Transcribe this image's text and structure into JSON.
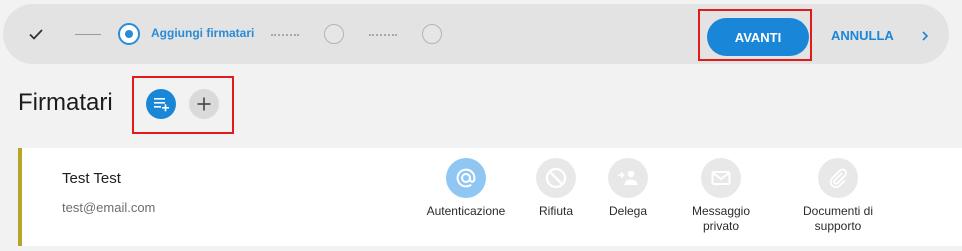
{
  "stepper": {
    "current_step_label": "Aggiungi firmatari",
    "next_label": "AVANTI",
    "cancel_label": "ANNULLA"
  },
  "section": {
    "title": "Firmatari"
  },
  "signer": {
    "name": "Test Test",
    "email": "test@email.com",
    "actions": [
      {
        "label": "Autenticazione",
        "icon": "at-icon",
        "active": true
      },
      {
        "label": "Rifiuta",
        "icon": "block-icon",
        "active": false
      },
      {
        "label": "Delega",
        "icon": "delegate-person-icon",
        "active": false
      },
      {
        "label": "Messaggio privato",
        "icon": "mail-icon",
        "active": false
      },
      {
        "label": "Documenti di supporto",
        "icon": "paperclip-icon",
        "active": false
      }
    ]
  },
  "colors": {
    "accent": "#1a86d8",
    "highlight": "#e01b1b",
    "card_border": "#b7a52a"
  }
}
